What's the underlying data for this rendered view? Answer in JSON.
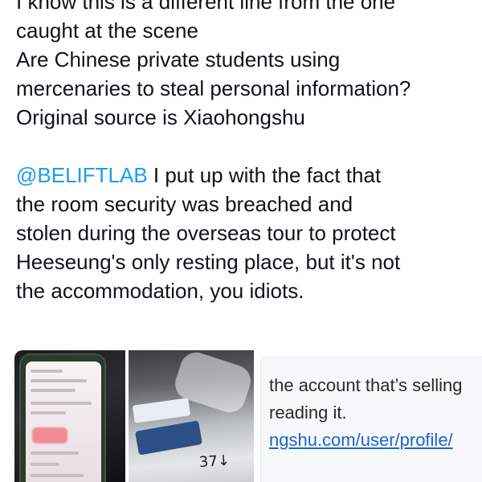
{
  "tweet": {
    "lines": [
      "I know this is a different line from the one",
      "caught at the scene",
      "Are Chinese private students using",
      "mercenaries to steal personal information?",
      "Original source is Xiaohongshu"
    ],
    "quote_mention": "@BELIFTLAB",
    "quote_lines": [
      " I put up with the fact that",
      "the room security was breached and",
      "stolen during the overseas tour to protect",
      "Heeseung's only resting place, but it's not",
      "the accommodation, you idiots."
    ]
  },
  "media": {
    "bag_number": "37↓",
    "screenshot": {
      "line1": "the account that’s sellinɡ",
      "line2": "reading it.",
      "link": "ngshu.com/user/profile/"
    }
  },
  "colors": {
    "mention": "#1d9bf0",
    "text": "#0f1419",
    "link": "#1a66c9"
  }
}
